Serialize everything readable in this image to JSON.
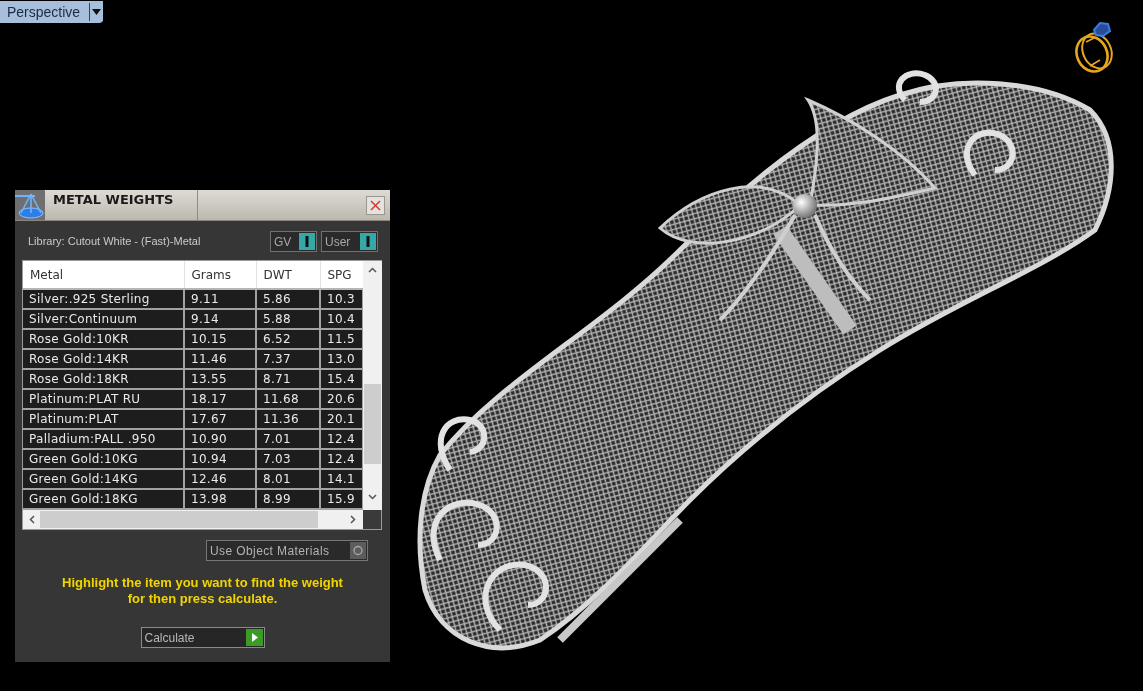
{
  "viewport": {
    "label": "Perspective"
  },
  "panel": {
    "title": "METAL WEIGHTS",
    "library": "Library: Cutout White - (Fast)-Metal",
    "toggles": [
      {
        "label": "GV",
        "on": true
      },
      {
        "label": "User",
        "on": true
      }
    ],
    "table": {
      "columns": [
        "Metal",
        "Grams",
        "DWT",
        "SPG"
      ],
      "rows": [
        {
          "cells": [
            "Silver:.925 Sterling",
            "9.11",
            "5.86",
            "10.3"
          ],
          "selected": false
        },
        {
          "cells": [
            "Silver:Continuum",
            "9.14",
            "5.88",
            "10.4"
          ],
          "selected": false
        },
        {
          "cells": [
            "Rose Gold:10KR",
            "10.15",
            "6.52",
            "11.5"
          ],
          "selected": false
        },
        {
          "cells": [
            "Rose Gold:14KR",
            "11.46",
            "7.37",
            "13.0"
          ],
          "selected": false
        },
        {
          "cells": [
            "Rose Gold:18KR",
            "13.55",
            "8.71",
            "15.4"
          ],
          "selected": false
        },
        {
          "cells": [
            "Platinum:PLAT RU",
            "18.17",
            "11.68",
            "20.6"
          ],
          "selected": false
        },
        {
          "cells": [
            "Platinum:PLAT",
            "17.67",
            "11.36",
            "20.1"
          ],
          "selected": false
        },
        {
          "cells": [
            "Palladium:PALL .950",
            "10.90",
            "7.01",
            "12.4"
          ],
          "selected": false
        },
        {
          "cells": [
            "Green Gold:10KG",
            "10.94",
            "7.03",
            "12.4"
          ],
          "selected": false
        },
        {
          "cells": [
            "Green Gold:14KG",
            "12.46",
            "8.01",
            "14.1"
          ],
          "selected": false
        },
        {
          "cells": [
            "Green Gold:18KG",
            "13.98",
            "8.99",
            "15.9"
          ],
          "selected": false
        }
      ]
    },
    "option": {
      "label": "Use Object Materials",
      "on": false
    },
    "instructions": "Highlight the item you want to find the weight for then press calculate.",
    "calculate_button": "Calculate"
  }
}
